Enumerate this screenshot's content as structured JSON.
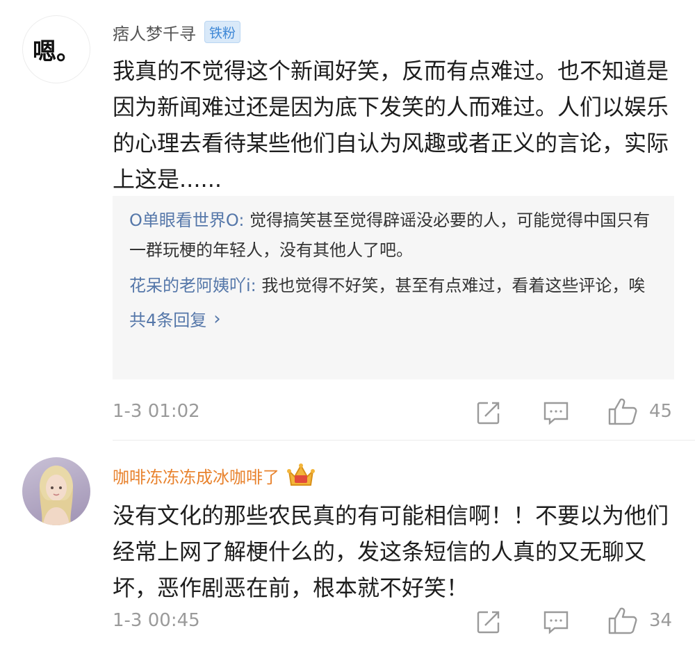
{
  "comments": [
    {
      "avatar_text": "嗯。",
      "username": "痞人梦千寻",
      "badge": "铁粉",
      "text": "我真的不觉得这个新闻好笑，反而有点难过。也不知道是因为新闻难过还是因为底下发笑的人而难过。人们以娱乐的心理去看待某些他们自认为风趣或者正义的言论，实际上这是......",
      "replies": [
        {
          "author": "O单眼看世界O",
          "colon": ":",
          "text": " 觉得搞笑甚至觉得辟谣没必要的人，可能觉得中国只有一群玩梗的年轻人，没有其他人了吧。"
        },
        {
          "author": "花呆的老阿姨吖i",
          "colon": ":",
          "text": " 我也觉得不好笑，甚至有点难过，看着这些评论，唉"
        }
      ],
      "more_replies": "共4条回复",
      "more_icon": "chevron-right-icon",
      "time": "1-3 01:02",
      "likes": "45",
      "colors": {
        "username": "#555555",
        "badge_bg": "#d9e9f9",
        "badge_text": "#3f88d6"
      }
    },
    {
      "avatar_icon": "user-avatar-photo",
      "username": "咖啡冻冻冻成冰咖啡了",
      "badge_icon": "crown-icon",
      "text": "没有文化的那些农民真的有可能相信啊！！不要以为他们经常上网了解梗什么的，发这条短信的人真的又无聊又坏，恶作剧恶在前，根本就不好笑！",
      "time": "1-3 00:45",
      "likes": "34",
      "colors": {
        "username": "#e8822d"
      }
    }
  ],
  "colors": {
    "link": "#5577a9",
    "meta": "#9a9a9a",
    "reply_bg": "#f6f6f6"
  }
}
